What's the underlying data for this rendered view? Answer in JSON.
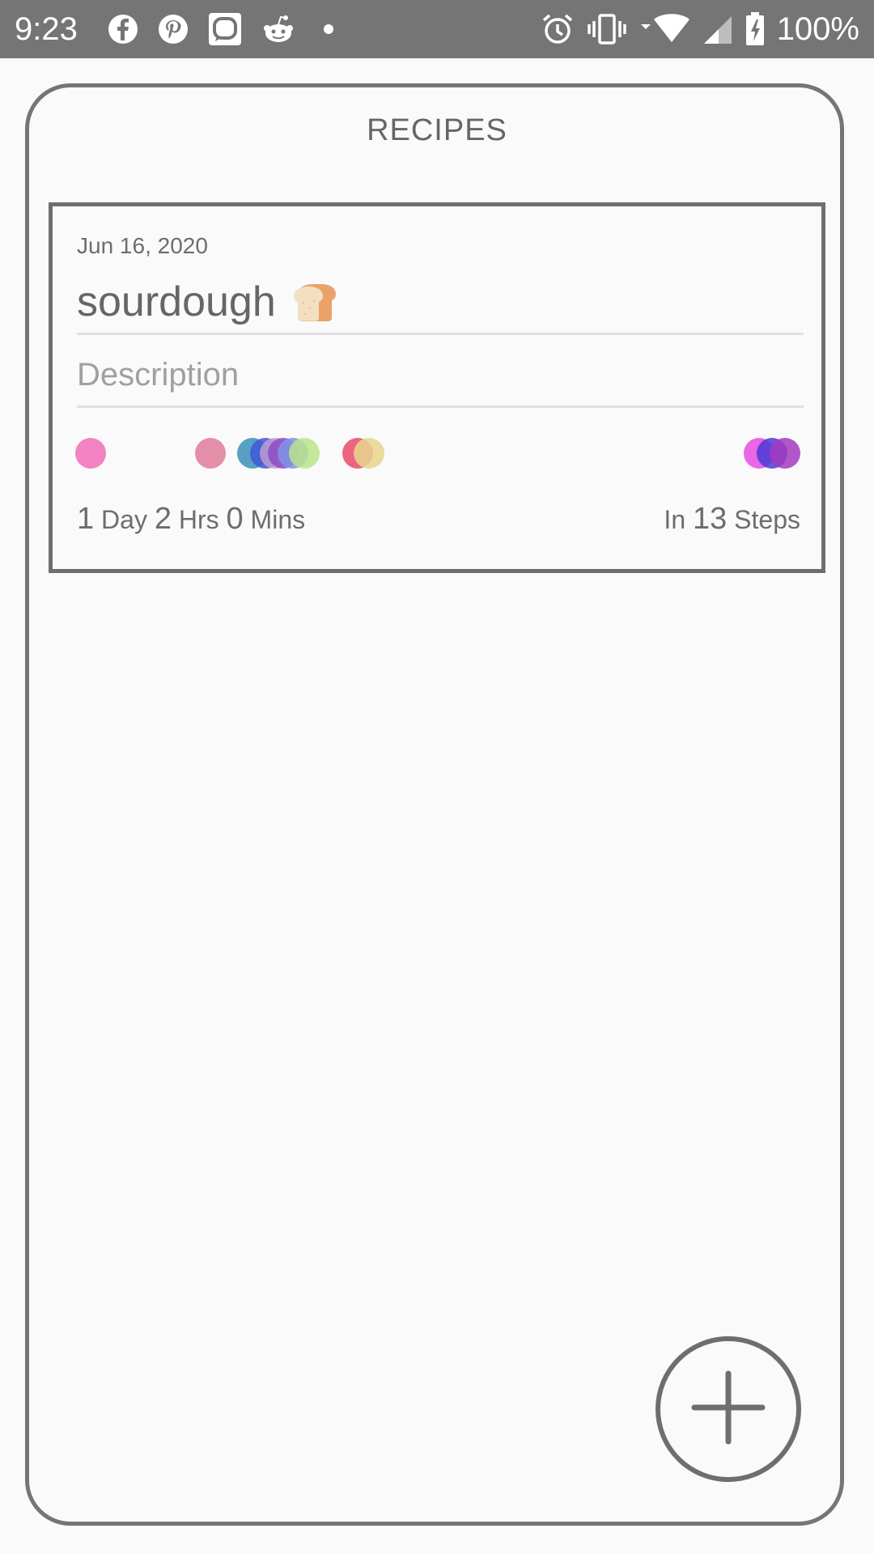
{
  "status_bar": {
    "time": "9:23",
    "battery_percent": "100%",
    "left_icons": [
      "facebook-icon",
      "pinterest-icon",
      "messenger-lite-icon",
      "reddit-icon",
      "more-notifications-dot-icon"
    ],
    "right_icons": [
      "alarm-icon",
      "vibrate-icon",
      "wifi-icon",
      "signal-icon",
      "battery-charging-icon"
    ]
  },
  "header": {
    "title": "RECIPES"
  },
  "recipes": [
    {
      "date": "Jun 16, 2020",
      "title": "sourdough",
      "title_emoji": "bread-icon",
      "description_placeholder": "Description",
      "duration": {
        "days": "1",
        "days_unit": "Day",
        "hours": "2",
        "hours_unit": "Hrs",
        "minutes": "0",
        "minutes_unit": "Mins"
      },
      "steps": {
        "prefix": "In",
        "count": "13",
        "unit": "Steps"
      },
      "step_colors": [
        "#f06cba",
        "#df7a9b",
        "#3a8fb8",
        "#3f57d6",
        "#c09ad0",
        "#8c4cc4",
        "#7f94e6",
        "#b8e48a",
        "#e84a6a",
        "#e8d68c",
        "#e64ce0",
        "#4b3ad8",
        "#a23ac0"
      ]
    }
  ],
  "fab": {
    "icon": "plus-icon"
  }
}
